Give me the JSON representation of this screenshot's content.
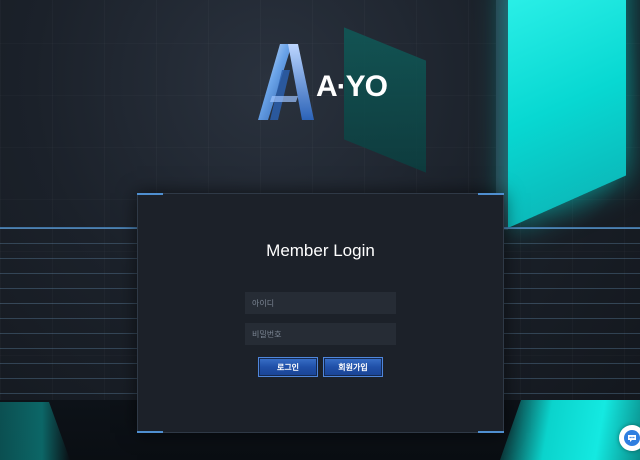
{
  "logo": {
    "text": "A·YO",
    "alt": "A-YO logo"
  },
  "login": {
    "title": "Member Login",
    "id_placeholder": "아이디",
    "pw_placeholder": "비밀번호",
    "login_button": "로그인",
    "join_button": "회원가입"
  },
  "chat": {
    "icon": "chat-bubble-icon"
  },
  "colors": {
    "accent_blue": "#2456b0",
    "cyan": "#14e9e1",
    "panel_bg": "#1c2129"
  }
}
